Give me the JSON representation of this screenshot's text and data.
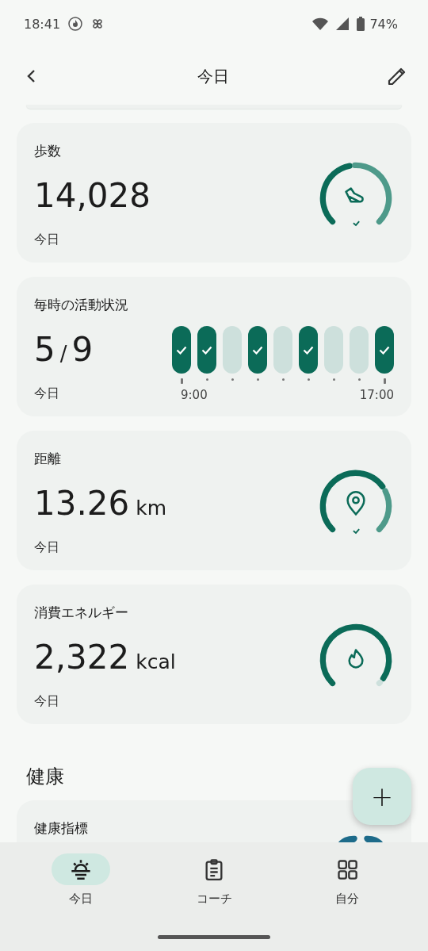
{
  "status_bar": {
    "time": "18:41",
    "battery": "74%"
  },
  "header": {
    "title": "今日"
  },
  "cards": [
    {
      "kind": "ring",
      "title": "歩数",
      "value": "14,028",
      "period": "今日",
      "goal_met": true
    },
    {
      "kind": "hourly",
      "title": "毎時の活動状況",
      "value": "5",
      "separator": "/",
      "total": "9",
      "period": "今日",
      "start_label": "9:00",
      "end_label": "17:00",
      "hours": [
        {
          "done": true
        },
        {
          "done": true
        },
        {
          "done": false
        },
        {
          "done": true
        },
        {
          "done": false
        },
        {
          "done": true
        },
        {
          "done": false
        },
        {
          "done": false
        },
        {
          "done": true
        }
      ]
    },
    {
      "kind": "ring",
      "title": "距離",
      "value": "13.26",
      "unit": "km",
      "period": "今日",
      "goal_met": true
    },
    {
      "kind": "ring",
      "title": "消費エネルギー",
      "value": "2,322",
      "unit": "kcal",
      "period": "今日",
      "goal_met": false
    }
  ],
  "section": {
    "title": "健康",
    "card_title": "健康指標"
  },
  "fab": {
    "label": "+"
  },
  "nav": [
    {
      "label": "今日",
      "selected": true
    },
    {
      "label": "コーチ",
      "selected": false
    },
    {
      "label": "自分",
      "selected": false
    }
  ]
}
